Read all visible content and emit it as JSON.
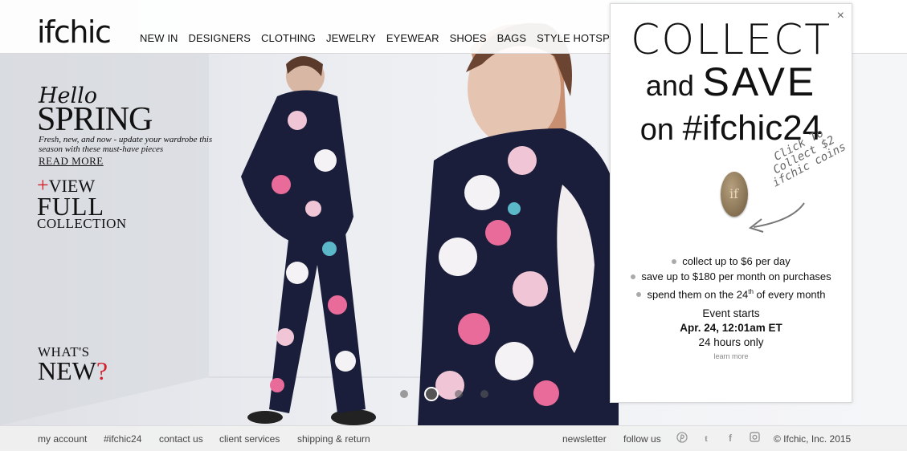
{
  "header": {
    "logo": "ifchic",
    "nav": [
      "NEW IN",
      "DESIGNERS",
      "CLOTHING",
      "JEWELRY",
      "EYEWEAR",
      "SHOES",
      "BAGS",
      "STYLE HOTSPOT"
    ]
  },
  "hero": {
    "hello": "Hello",
    "spring": "SPRING",
    "tagline": "Fresh, new, and now - update your wardrobe this season with these must-have pieces",
    "read_more": "READ MORE",
    "plus": "+",
    "view": "VIEW",
    "full": "FULL",
    "collection": "COLLECTION",
    "whats": "WHAT'S",
    "new": "NEW",
    "question": "?",
    "slides": 4,
    "active_slide": 2
  },
  "popup": {
    "line1": "COLLECT",
    "and": "and",
    "save": "SAVE",
    "on": "on",
    "hashtag": "#ifchic24",
    "click_note": "Click To Collect $2 ifchic coins",
    "coin_mark": "if",
    "bullets": [
      {
        "text": "collect up to $6 per day"
      },
      {
        "text": "save up to $180 per month on purchases"
      },
      {
        "pre": "spend them on the 24",
        "sup": "th",
        "post": " of every month"
      }
    ],
    "event_starts": "Event starts",
    "event_date": "Apr. 24, 12:01am ET",
    "event_duration": "24 hours only",
    "learn_more": "learn more",
    "close": "×"
  },
  "footer": {
    "links": [
      "my account",
      "#ifchic24",
      "contact us",
      "client services",
      "shipping & return"
    ],
    "newsletter": "newsletter",
    "follow": "follow us",
    "social_icons": [
      "pinterest-icon",
      "tumblr-icon",
      "facebook-icon",
      "instagram-icon"
    ],
    "copyright": "© Ifchic, Inc. 2015"
  },
  "colors": {
    "accent_red": "#d41f2b",
    "text": "#111111",
    "footer_bg": "#f0f0f0"
  }
}
